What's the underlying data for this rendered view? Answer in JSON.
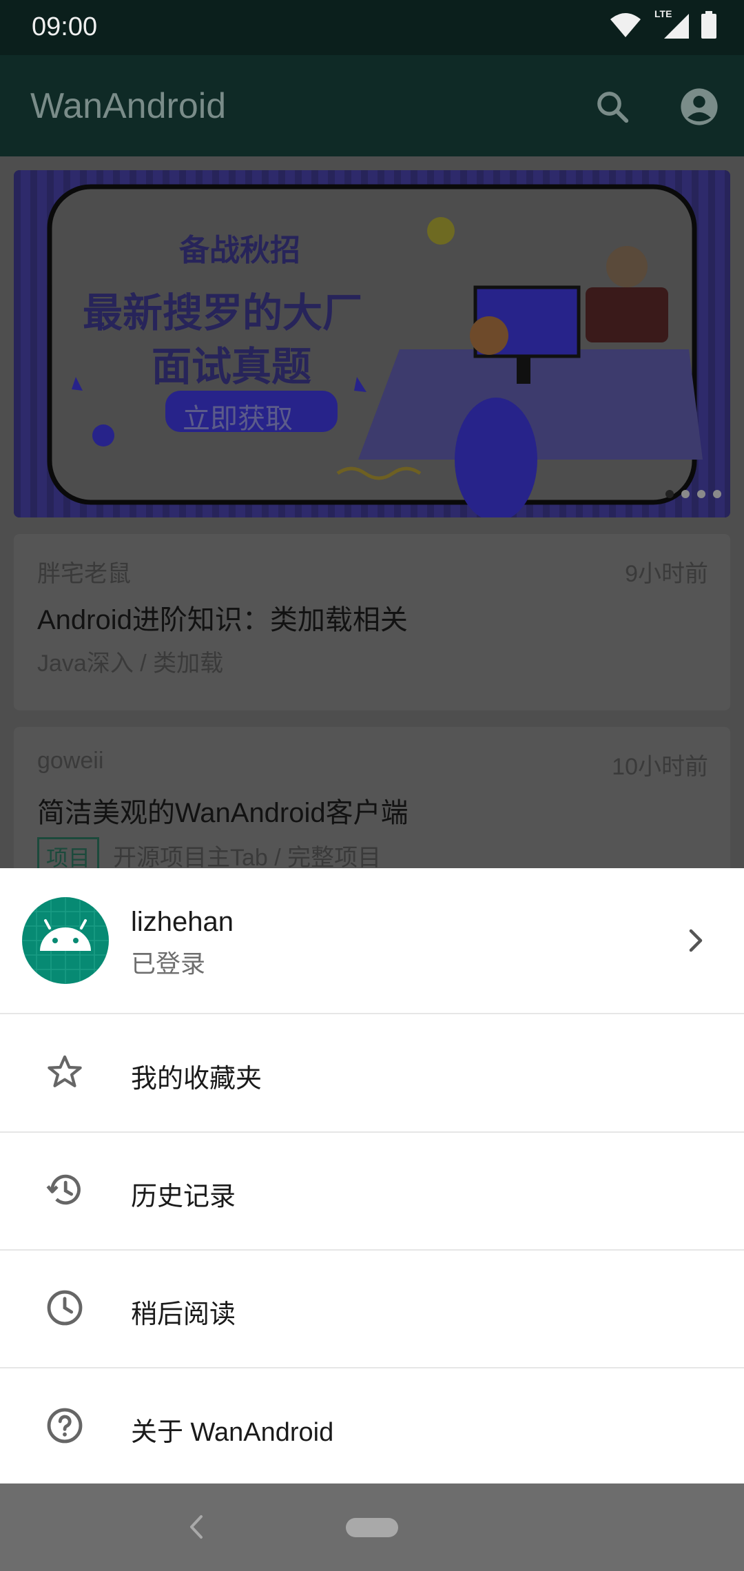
{
  "status_bar": {
    "time": "09:00",
    "network_label": "LTE"
  },
  "app_bar": {
    "title": "WanAndroid",
    "search_icon": "search-icon",
    "account_icon": "account-circle-icon"
  },
  "banner": {
    "line1": "备战秋招",
    "line2": "最新搜罗的大厂",
    "line3": "面试真题",
    "cta": "立即获取"
  },
  "articles": [
    {
      "author": "胖宅老鼠",
      "time": "9小时前",
      "title": "Android进阶知识：类加载相关",
      "category": "Java深入 / 类加载"
    },
    {
      "author": "goweii",
      "time": "10小时前",
      "title": "简洁美观的WanAndroid客户端",
      "tag": "项目",
      "category": "开源项目主Tab / 完整项目"
    }
  ],
  "sheet": {
    "username": "lizhehan",
    "login_status": "已登录",
    "menu": [
      {
        "label": "我的收藏夹",
        "icon": "star-outline-icon"
      },
      {
        "label": "历史记录",
        "icon": "history-icon"
      },
      {
        "label": "稍后阅读",
        "icon": "clock-icon"
      },
      {
        "label": "关于 WanAndroid",
        "icon": "help-circle-icon"
      }
    ]
  },
  "colors": {
    "primary": "#078a73",
    "sheet_bg": "#ffffff",
    "scrim": "#000000"
  }
}
